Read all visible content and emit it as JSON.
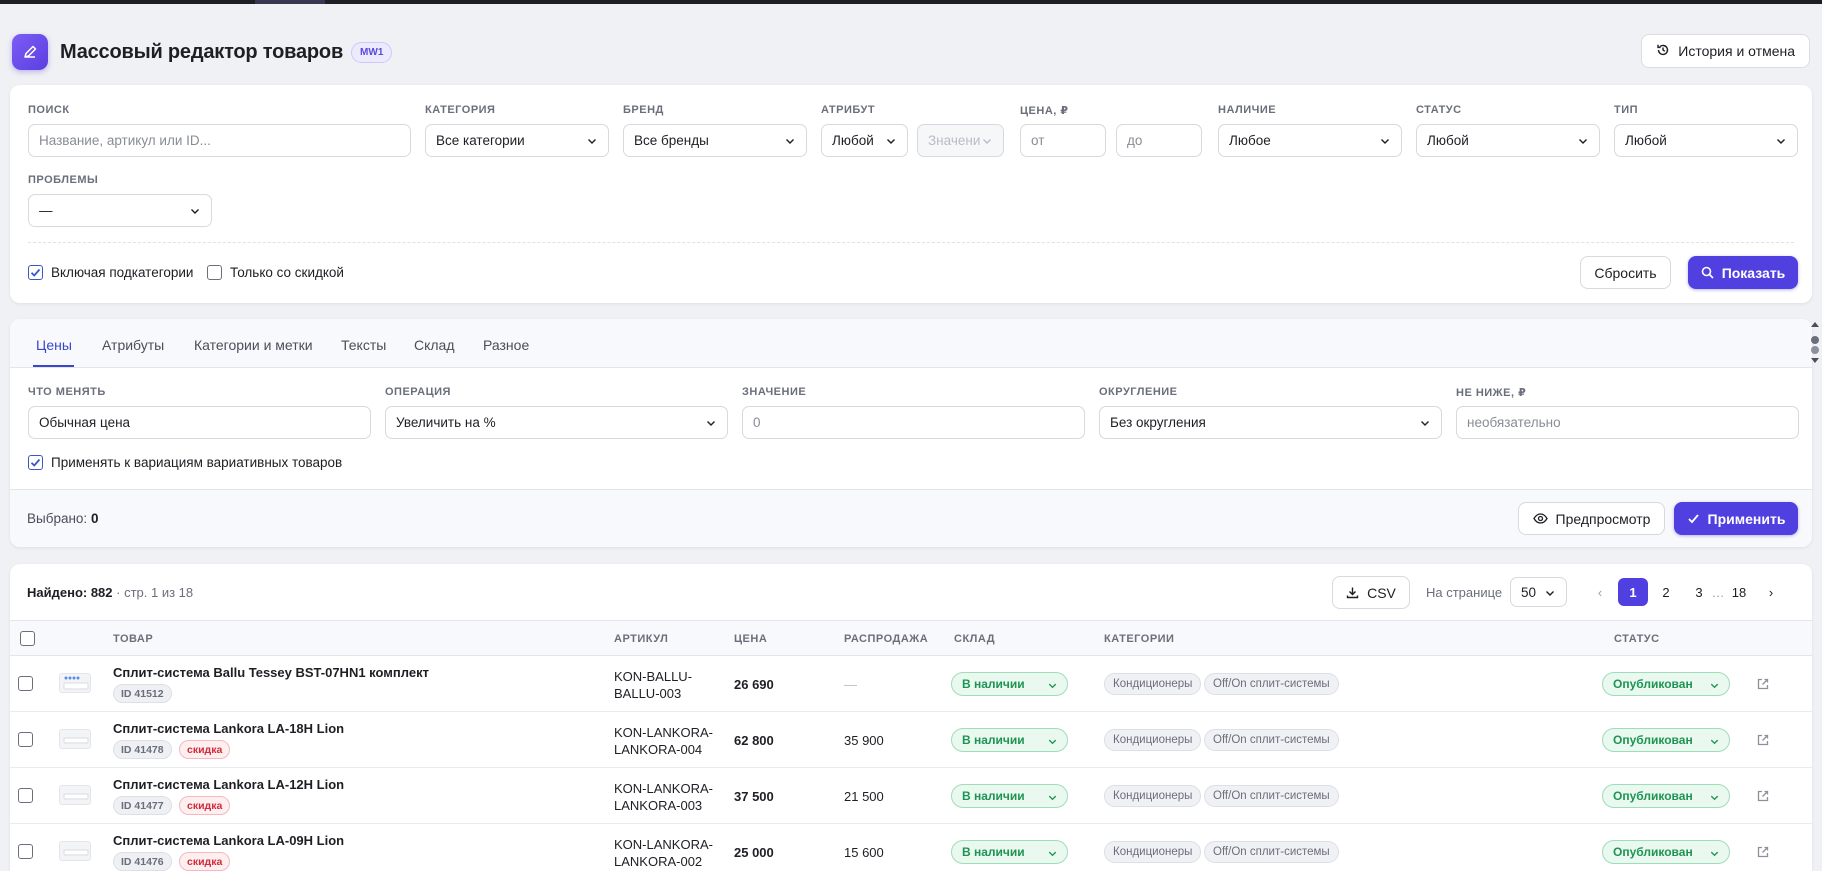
{
  "header": {
    "title": "Массовый редактор товаров",
    "badge": "MW1",
    "history_button": "История и отмена"
  },
  "filters": {
    "search": {
      "label": "ПОИСК",
      "placeholder": "Название, артикул или ID..."
    },
    "category": {
      "label": "КАТЕГОРИЯ",
      "value": "Все категории"
    },
    "brand": {
      "label": "БРЕНД",
      "value": "Все бренды"
    },
    "attribute": {
      "label": "АТРИБУТ",
      "value": "Любой",
      "value_placeholder": "Значени"
    },
    "price": {
      "label": "ЦЕНА, ₽",
      "from_placeholder": "от",
      "to_placeholder": "до"
    },
    "availability": {
      "label": "НАЛИЧИЕ",
      "value": "Любое"
    },
    "status": {
      "label": "СТАТУС",
      "value": "Любой"
    },
    "type": {
      "label": "ТИП",
      "value": "Любой"
    },
    "problems": {
      "label": "ПРОБЛЕМЫ",
      "value": "—"
    },
    "include_subcategories": {
      "label": "Включая подкатегории",
      "checked": true
    },
    "only_discount": {
      "label": "Только со скидкой",
      "checked": false
    },
    "reset_button": "Сбросить",
    "show_button": "Показать"
  },
  "editor": {
    "tabs": [
      "Цены",
      "Атрибуты",
      "Категории и метки",
      "Тексты",
      "Склад",
      "Разное"
    ],
    "active_tab": "Цены",
    "what_to_change": {
      "label": "ЧТО МЕНЯТЬ",
      "value": "Обычная цена"
    },
    "operation": {
      "label": "ОПЕРАЦИЯ",
      "value": "Увеличить на %"
    },
    "amount": {
      "label": "ЗНАЧЕНИЕ",
      "value": "0"
    },
    "rounding": {
      "label": "ОКРУГЛЕНИЕ",
      "value": "Без округления"
    },
    "min_price": {
      "label": "НЕ НИЖЕ, ₽",
      "placeholder": "необязательно"
    },
    "apply_to_variations": {
      "label": "Применять к вариациям вариативных товаров",
      "checked": true
    },
    "selected_label": "Выбрано:",
    "selected_count": "0",
    "preview_button": "Предпросмотр",
    "apply_button": "Применить"
  },
  "results": {
    "found_label": "Найдено: 882",
    "page_info": "· стр. 1 из 18",
    "csv_button": "CSV",
    "per_page_label": "На странице",
    "per_page_value": "50",
    "pages": [
      "1",
      "2",
      "3",
      "…",
      "18"
    ],
    "prev": "‹",
    "next": "›",
    "columns": {
      "product": "ТОВАР",
      "sku": "АРТИКУЛ",
      "price": "ЦЕНА",
      "sale": "РАСПРОДАЖА",
      "stock": "СКЛАД",
      "categories": "КАТЕГОРИИ",
      "status": "СТАТУС"
    },
    "rows": [
      {
        "name": "Сплит-система Ballu Tessey BST-07HN1 комплект",
        "id": "ID 41512",
        "sale_tag": "",
        "sku_1": "KON-BALLU-",
        "sku_2": "BALLU-003",
        "price": "26 690",
        "sale": "—",
        "stock": "В наличии",
        "cat_1": "Кондиционеры",
        "cat_2": "Off/On сплит-системы",
        "status": "Опубликован"
      },
      {
        "name": "Сплит-система Lankora LA-18H Lion",
        "id": "ID 41478",
        "sale_tag": "скидка",
        "sku_1": "KON-LANKORA-",
        "sku_2": "LANKORA-004",
        "price": "62 800",
        "sale": "35 900",
        "stock": "В наличии",
        "cat_1": "Кондиционеры",
        "cat_2": "Off/On сплит-системы",
        "status": "Опубликован"
      },
      {
        "name": "Сплит-система Lankora LA-12H Lion",
        "id": "ID 41477",
        "sale_tag": "скидка",
        "sku_1": "KON-LANKORA-",
        "sku_2": "LANKORA-003",
        "price": "37 500",
        "sale": "21 500",
        "stock": "В наличии",
        "cat_1": "Кондиционеры",
        "cat_2": "Off/On сплит-системы",
        "status": "Опубликован"
      },
      {
        "name": "Сплит-система Lankora LA-09H Lion",
        "id": "ID 41476",
        "sale_tag": "скидка",
        "sku_1": "KON-LANKORA-",
        "sku_2": "LANKORA-002",
        "price": "25 000",
        "sale": "15 600",
        "stock": "В наличии",
        "cat_1": "Кондиционеры",
        "cat_2": "Off/On сплит-системы",
        "status": "Опубликован"
      }
    ]
  },
  "colors": {
    "primary": "#5140e0",
    "success": "#1f9452",
    "danger": "#d22a3a"
  },
  "icons": [
    "pencil-icon",
    "history-icon",
    "chevron-down-icon",
    "search-icon",
    "eye-icon",
    "check-icon",
    "download-icon",
    "external-link-icon"
  ]
}
